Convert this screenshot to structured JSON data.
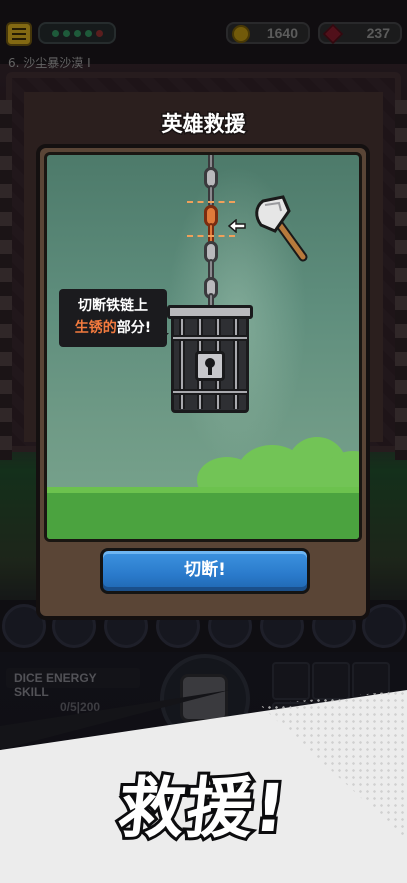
{
  "header": {
    "coins": "1640",
    "gems": "237",
    "stage": "6. 沙尘暴沙漠 I"
  },
  "skills": {
    "dice_energy_label": "DICE ENERGY SKILL",
    "energy_count": "0/5|200"
  },
  "modal": {
    "title": "英雄救援",
    "hint_line1": "切断铁链上",
    "hint_rust": "生锈的",
    "hint_tail": "部分!",
    "cut_button": "切断!"
  },
  "banner": {
    "title": "救援!"
  },
  "colors": {
    "accent_blue": "#2a7acb",
    "rust_orange": "#f27a3e",
    "grass_green": "#4ba33f"
  },
  "icons": [
    "menu-icon",
    "coin-icon",
    "gem-icon",
    "axe-icon",
    "arrow-left-icon",
    "cage-icon",
    "lock-icon",
    "dice-icon"
  ]
}
